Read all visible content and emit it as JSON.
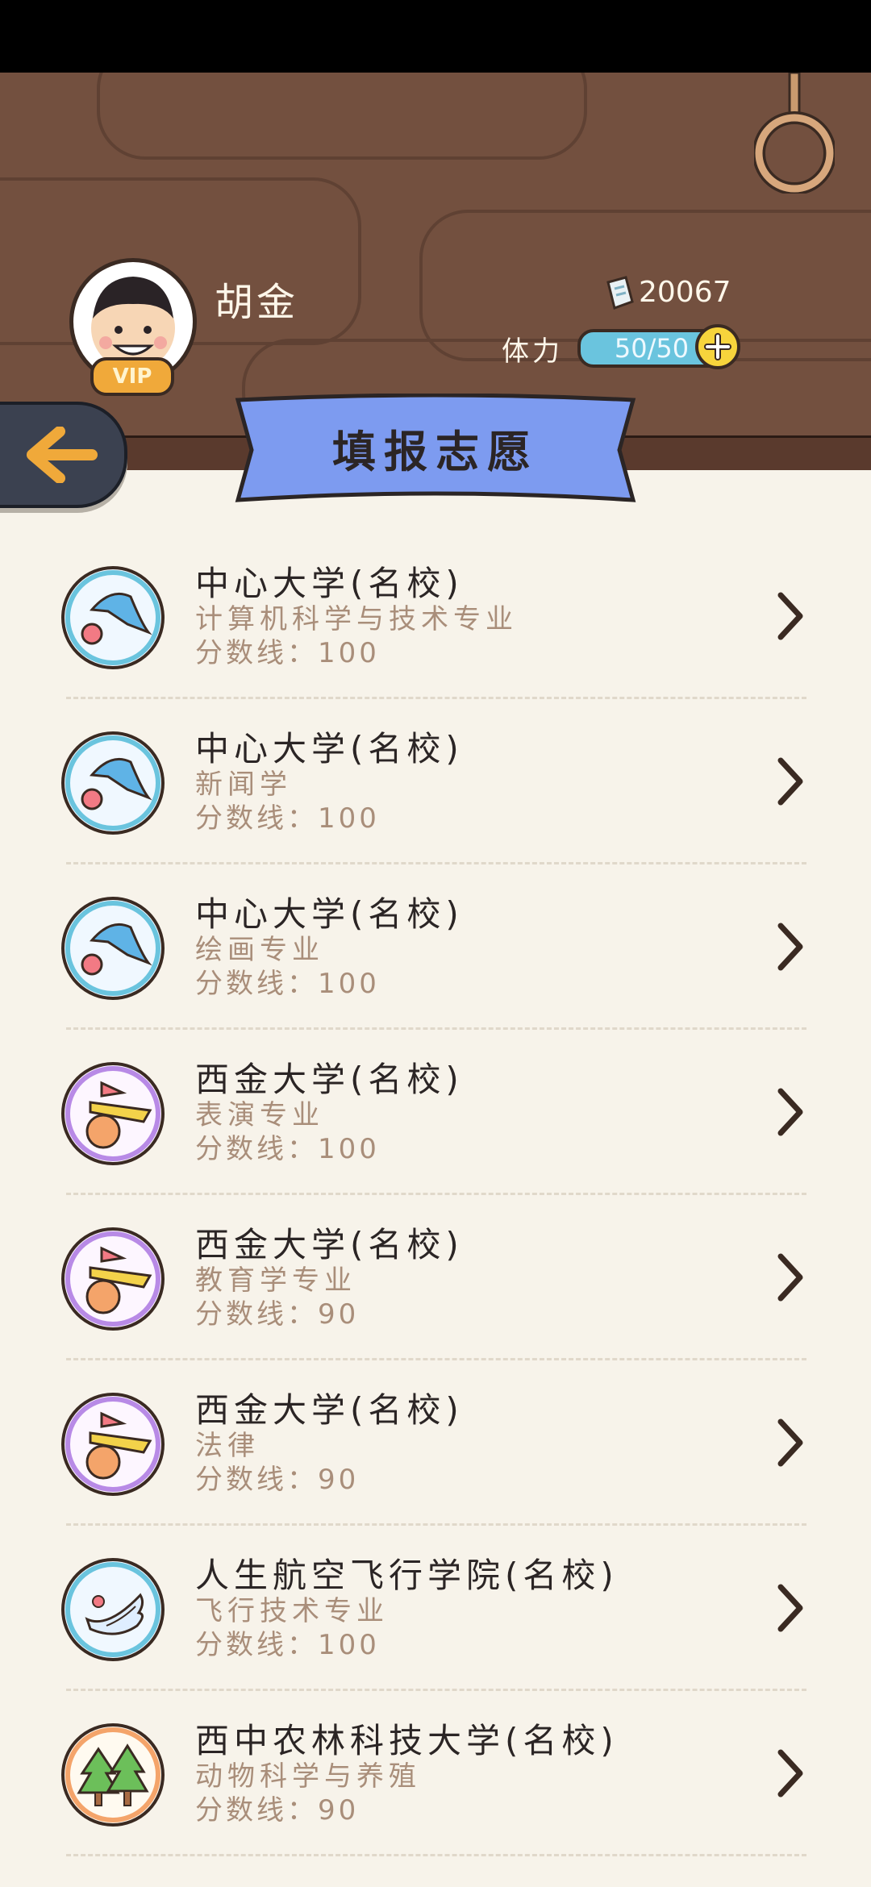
{
  "user": {
    "name": "胡金",
    "vip_label": "VIP",
    "coins": "20067",
    "stamina_label": "体力",
    "stamina": "50/50"
  },
  "title": "填报志愿",
  "colors": {
    "header_wood": "#73503f",
    "banner": "#7d9bf0",
    "background": "#f7f3ea",
    "stamina": "#6ac4de",
    "plus": "#f7d43c"
  },
  "list": [
    {
      "school": "中心大学(名校)",
      "major": "计算机科学与技术专业",
      "score": "分数线：100",
      "logo": "blue-swoosh-icon"
    },
    {
      "school": "中心大学(名校)",
      "major": "新闻学",
      "score": "分数线：100",
      "logo": "blue-swoosh-icon"
    },
    {
      "school": "中心大学(名校)",
      "major": "绘画专业",
      "score": "分数线：100",
      "logo": "blue-swoosh-icon"
    },
    {
      "school": "西金大学(名校)",
      "major": "表演专业",
      "score": "分数线：100",
      "logo": "purple-shapes-icon"
    },
    {
      "school": "西金大学(名校)",
      "major": "教育学专业",
      "score": "分数线：90",
      "logo": "purple-shapes-icon"
    },
    {
      "school": "西金大学(名校)",
      "major": "法律",
      "score": "分数线：90",
      "logo": "purple-shapes-icon"
    },
    {
      "school": "人生航空飞行学院(名校)",
      "major": "飞行技术专业",
      "score": "分数线：100",
      "logo": "wing-icon"
    },
    {
      "school": "西中农林科技大学(名校)",
      "major": "动物科学与养殖",
      "score": "分数线：90",
      "logo": "trees-icon"
    }
  ]
}
